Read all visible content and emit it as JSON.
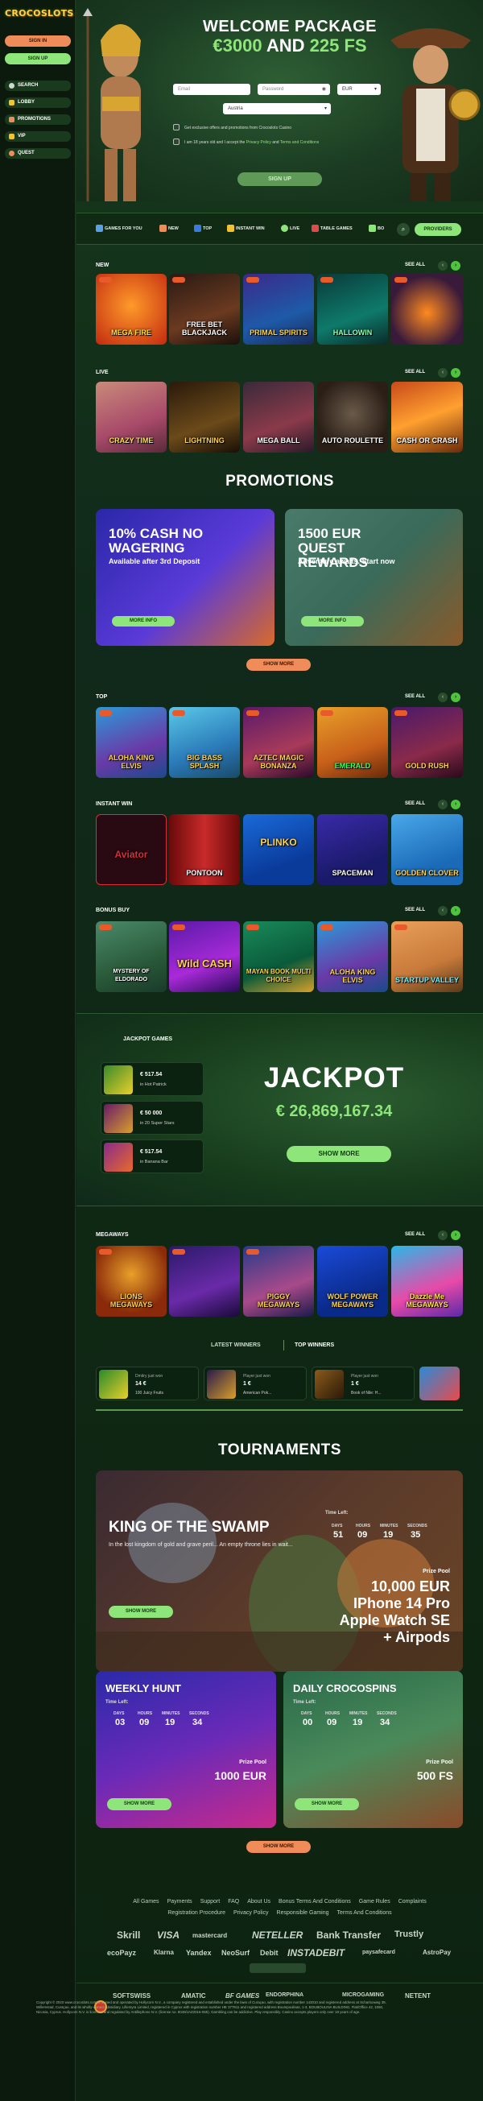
{
  "sidebar": {
    "logo": "CROCOSLOTS",
    "sign_in": "SIGN IN",
    "sign_up": "SIGN UP",
    "nav": [
      {
        "label": "SEARCH",
        "icon": "search-icon"
      },
      {
        "label": "LOBBY",
        "icon": "lobby-icon"
      },
      {
        "label": "PROMOTIONS",
        "icon": "gift-icon"
      },
      {
        "label": "VIP",
        "icon": "crown-icon"
      },
      {
        "label": "QUEST",
        "icon": "quest-icon"
      }
    ]
  },
  "hero": {
    "title": "WELCOME PACKAGE",
    "amount": "€3000",
    "and": "AND",
    "fs": "225 FS",
    "email_placeholder": "Email",
    "password_placeholder": "Password",
    "currency": "EUR",
    "country": "Austria",
    "check1": "Get exclusive offers and promotions from Crocoslots Casino",
    "check2_prefix": "I am 18 years old and I accept the",
    "privacy": "Privacy Policy",
    "and_word": "and",
    "terms": "Terms and Conditions",
    "signup": "SIGN UP"
  },
  "categories": [
    {
      "label": "GAMES FOR YOU",
      "color": "#5aa0e6"
    },
    {
      "label": "NEW",
      "color": "#f08c5a"
    },
    {
      "label": "TOP",
      "color": "#3a7be0"
    },
    {
      "label": "INSTANT WIN",
      "color": "#f2c230"
    },
    {
      "label": "LIVE",
      "color": "#8ee67a"
    },
    {
      "label": "TABLE GAMES",
      "color": "#e04a4a"
    },
    {
      "label": "BO",
      "color": "#8ee67a"
    }
  ],
  "providers": "PROVIDERS",
  "see_all": "SEE ALL",
  "rows": {
    "new": {
      "label": "NEW",
      "tiles": [
        "MEGA FIRE",
        "FREE BET BLACKJACK",
        "PRIMAL SPIRITS",
        "HALLOWIN",
        "",
        ""
      ]
    },
    "live": {
      "label": "LIVE",
      "tiles": [
        "CRAZY TIME",
        "LIGHTNING",
        "MEGA BALL",
        "AUTO ROULETTE",
        "CASH OR CRASH"
      ]
    },
    "top": {
      "label": "TOP",
      "tiles": [
        "ALOHA KING ELVIS",
        "BIG BASS SPLASH",
        "AZTEC MAGIC BONANZA",
        "EMERALD",
        "GOLD RUSH"
      ]
    },
    "instant": {
      "label": "INSTANT WIN",
      "tiles": [
        "Aviator",
        "PONTOON",
        "PLINKO",
        "SPACEMAN",
        "GOLDEN CLOVER"
      ]
    },
    "bonus": {
      "label": "BONUS BUY",
      "tiles": [
        "MYSTERY OF ELDORADO",
        "Wild CASH",
        "MAYAN BOOK MULTI CHOICE",
        "ALOHA KING ELVIS",
        "STARTUP VALLEY"
      ]
    },
    "megaways": {
      "label": "MEGAWAYS",
      "tiles": [
        "LIONS MEGAWAYS",
        "",
        "PIGGY MEGAWAYS",
        "WOLF POWER MEGAWAYS",
        "Dazzle Me MEGAWAYS"
      ]
    }
  },
  "promotions": {
    "title": "PROMOTIONS",
    "cards": [
      {
        "title": "10% CASH NO WAGERING",
        "sub": "Available after 3rd Deposit",
        "btn": "MORE INFO"
      },
      {
        "title": "1500 EUR QUEST REWARDS",
        "sub": "Adventure awaits. Start now",
        "btn": "MORE INFO"
      }
    ],
    "show_more": "SHOW MORE"
  },
  "jackpot": {
    "games_title": "JACKPOT GAMES",
    "games": [
      {
        "amount": "€ 517.54",
        "name": "in Hot Patrick"
      },
      {
        "amount": "€ 50 000",
        "name": "in 20 Super Stars"
      },
      {
        "amount": "€ 517.54",
        "name": "in Banana Bar"
      }
    ],
    "title": "JACKPOT",
    "amount": "€ 26,869,167.34",
    "btn": "SHOW MORE"
  },
  "winners": {
    "tab1": "LATEST WINNERS",
    "tab2": "TOP WINNERS",
    "cards": [
      {
        "who": "Dmitry just won",
        "amount": "14 €",
        "game": "100 Juicy Fruits"
      },
      {
        "who": "Player just won",
        "amount": "1 €",
        "game": "American Pok..."
      },
      {
        "who": "Player just won",
        "amount": "1 €",
        "game": "Book of Nile: H..."
      }
    ]
  },
  "tournaments": {
    "title": "TOURNAMENTS",
    "main": {
      "name": "KING OF THE SWAMP",
      "desc": "In the lost kingdom of gold and grave peril... An empty throne lies in wait...",
      "time_left": "Time Left:",
      "labels": [
        "DAYS",
        "HOURS",
        "MINUTES",
        "SECONDS"
      ],
      "values": [
        "51",
        "09",
        "19",
        "35"
      ],
      "prize_label": "Prize Pool",
      "prize": [
        "10,000 EUR",
        "IPhone 14 Pro",
        "Apple Watch SE",
        "+ Airpods"
      ],
      "btn": "SHOW MORE"
    },
    "weekly": {
      "name": "WEEKLY HUNT",
      "time_left": "Time Left:",
      "labels": [
        "DAYS",
        "HOURS",
        "MINUTES",
        "SECONDS"
      ],
      "values": [
        "03",
        "09",
        "19",
        "34"
      ],
      "prize_label": "Prize Pool",
      "prize": "1000 EUR",
      "btn": "SHOW MORE"
    },
    "daily": {
      "name": "DAILY CROCOSPINS",
      "time_left": "Time Left:",
      "labels": [
        "DAYS",
        "HOURS",
        "MINUTES",
        "SECONDS"
      ],
      "values": [
        "00",
        "09",
        "19",
        "34"
      ],
      "prize_label": "Prize Pool",
      "prize": "500 FS",
      "btn": "SHOW MORE"
    },
    "show_more": "SHOW MORE"
  },
  "footer": {
    "links1": [
      "All Games",
      "Payments",
      "Support",
      "FAQ",
      "About Us",
      "Bonus Terms And Conditions",
      "Game Rules",
      "Complaints"
    ],
    "links2": [
      "Registration Procedure",
      "Privacy Policy",
      "Responsible Gaming",
      "Terms And Conditions"
    ],
    "pay1": [
      "Skrill",
      "VISA",
      "mastercard",
      "NETELLER",
      "Bank Transfer",
      "Trustly"
    ],
    "pay2": [
      "ecoPayz",
      "Klarna",
      "Yandex",
      "NeoSurf",
      "Debit",
      "INSTADEBIT",
      "paysafecard",
      "AstroPay"
    ],
    "providers": [
      "SOFTSWISS",
      "AMATIC",
      "BF GAMES",
      "ENDORPHINA",
      "MICROGAMING",
      "NETENT"
    ],
    "copyright": "Copyright © 2023 www.crocoslots.com is owned and operated by Hollycorn N.V., a company registered and established under the laws of Curaçao, with registration number 142010 and registered address at Scharlooweg 39, Willemstad, Curaçao, and its wholly-owned subsidiary, Lillemyra Limited, registered in Cyprus with registration number HE 377911 and registered address Boumpoulinas, 1-3, BOUBOULINA BUILDING, Flat/Office 42, 1060, Nicosia, Cyprus. Hollycorn N.V. is licensed and regulated by Antillephone N.V. (license no. 8048/JAZ2016-055). Gambling can be addictive. Play responsibly. Casino accepts players only over 18 years of age."
  }
}
